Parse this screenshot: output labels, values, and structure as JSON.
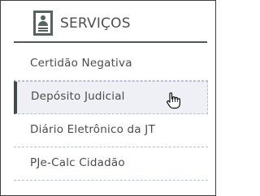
{
  "header": {
    "title": "SERVIÇOS",
    "icon": "profile-document-icon"
  },
  "menu": {
    "items": [
      {
        "label": "Certidão Negativa"
      },
      {
        "label": "Depósito Judicial"
      },
      {
        "label": "Diário Eletrônico da JT"
      },
      {
        "label": "PJe-Calc Cidadão"
      }
    ],
    "active_index": 1
  },
  "colors": {
    "header_rule": "#505a58",
    "icon": "#56635e",
    "active_bar": "#3e4a4c",
    "active_bg": "#eef0f5",
    "divider": "#b7bddc",
    "text": "#4b4b4b"
  },
  "pointer": {
    "icon": "hand-pointer-icon"
  }
}
